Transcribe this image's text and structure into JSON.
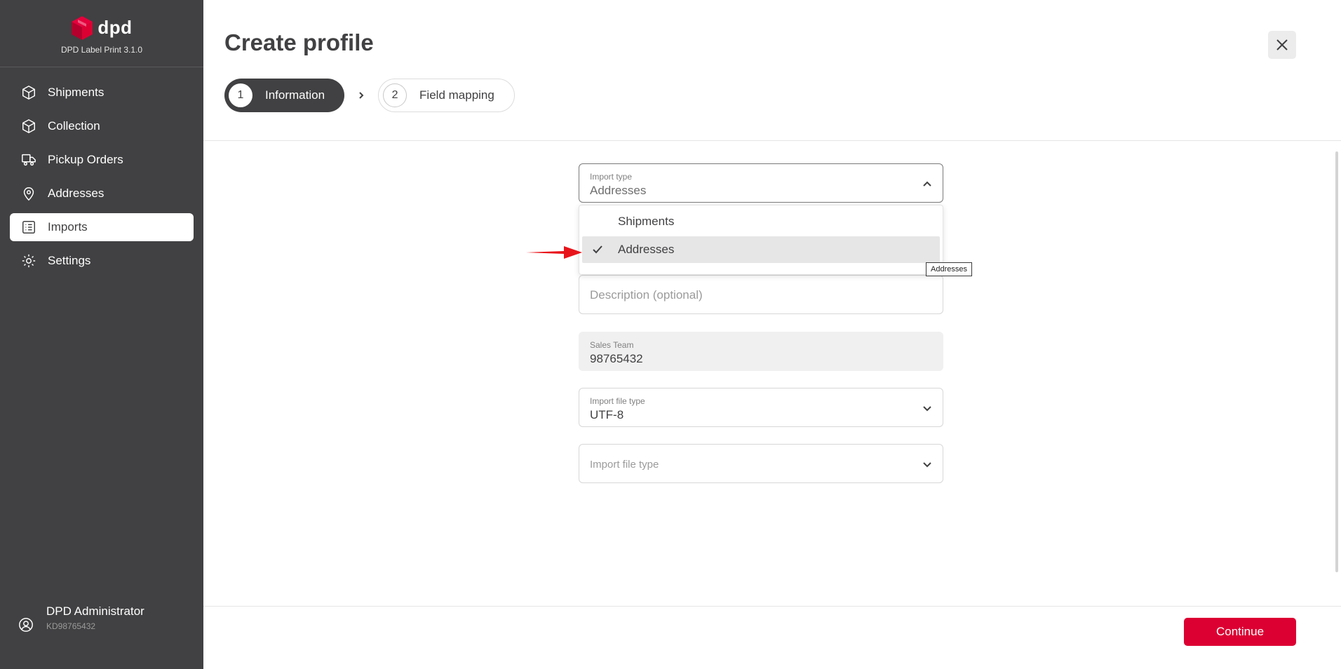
{
  "brand": {
    "name": "dpd",
    "version": "DPD Label Print 3.1.0"
  },
  "sidebar": {
    "items": [
      {
        "label": "Shipments",
        "icon": "box-icon"
      },
      {
        "label": "Collection",
        "icon": "box-icon"
      },
      {
        "label": "Pickup Orders",
        "icon": "truck-icon"
      },
      {
        "label": "Addresses",
        "icon": "location-pin-icon"
      },
      {
        "label": "Imports",
        "icon": "list-icon",
        "active": true
      },
      {
        "label": "Settings",
        "icon": "gear-icon"
      }
    ]
  },
  "user": {
    "name": "DPD Administrator",
    "id": "KD98765432",
    "icon": "user-circle-icon"
  },
  "page": {
    "title": "Create profile",
    "close_icon": "close-icon"
  },
  "stepper": {
    "steps": [
      {
        "number": "1",
        "label": "Information",
        "active": true
      },
      {
        "number": "2",
        "label": "Field mapping",
        "active": false
      }
    ]
  },
  "form": {
    "import_type": {
      "label": "Import type",
      "value": "Addresses"
    },
    "import_type_options": [
      {
        "label": "Shipments",
        "selected": false
      },
      {
        "label": "Addresses",
        "selected": true
      }
    ],
    "description": {
      "placeholder": "Description (optional)"
    },
    "sales_team": {
      "label": "Sales Team",
      "value": "98765432"
    },
    "file_encoding": {
      "label": "Import file type",
      "value": "UTF-8"
    },
    "file_type": {
      "placeholder": "Import file type"
    }
  },
  "tooltip": "Addresses",
  "footer": {
    "continue_label": "Continue"
  },
  "colors": {
    "sidebar_bg": "#414042",
    "brand_red": "#dc0032",
    "annotation_arrow": "#e8141b"
  }
}
